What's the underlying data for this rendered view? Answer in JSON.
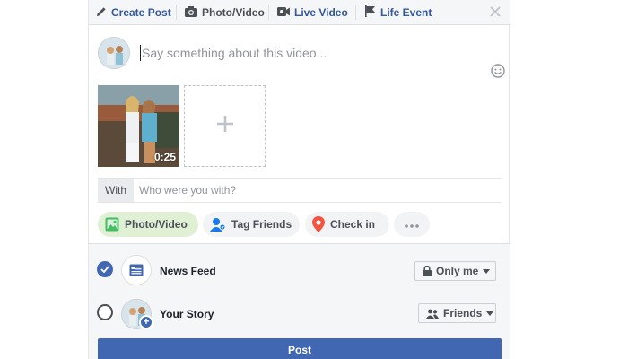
{
  "tabs": [
    {
      "label": "Create Post",
      "icon": "pencil-icon"
    },
    {
      "label": "Photo/Video",
      "icon": "camera-icon"
    },
    {
      "label": "Live Video",
      "icon": "video-camera-icon"
    },
    {
      "label": "Life Event",
      "icon": "flag-icon"
    }
  ],
  "compose": {
    "placeholder": "Say something about this video..."
  },
  "media": {
    "duration": "0:25"
  },
  "with": {
    "label": "With",
    "placeholder": "Who were you with?"
  },
  "actions": [
    {
      "label": "Photo/Video",
      "icon": "photo-icon"
    },
    {
      "label": "Tag Friends",
      "icon": "tag-friends-icon"
    },
    {
      "label": "Check in",
      "icon": "location-pin-icon"
    },
    {
      "label": "",
      "icon": "more-icon"
    }
  ],
  "destinations": {
    "news_feed": {
      "label": "News Feed",
      "checked": true,
      "audience": "Only me",
      "audience_icon": "lock-icon"
    },
    "your_story": {
      "label": "Your Story",
      "checked": false,
      "audience": "Friends",
      "audience_icon": "friends-icon"
    }
  },
  "post_label": "Post",
  "colors": {
    "accent": "#4267b2",
    "link": "#365899",
    "active_pill": "#dff0d5"
  }
}
